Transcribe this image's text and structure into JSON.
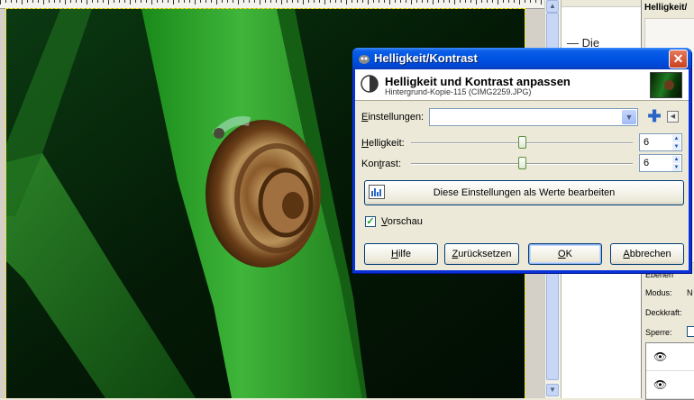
{
  "dialog": {
    "title": "Helligkeit/Kontrast",
    "header_title": "Helligkeit und Kontrast anpassen",
    "header_subtitle": "Hintergrund-Kopie-115 (CIMG2259.JPG)",
    "settings_label": "Einstellungen:",
    "settings_value": "",
    "brightness_label": "Helligkeit:",
    "brightness_value": "6",
    "contrast_label": "Kontrast:",
    "contrast_value": "6",
    "brightness_level": 0.5,
    "contrast_level": 0.5,
    "edit_values_label": "Diese Einstellungen als Werte bearbeiten",
    "preview_label": "Vorschau",
    "preview_checked": true,
    "buttons": {
      "help": "Hilfe",
      "reset": "Zurücksetzen",
      "ok": "OK",
      "cancel": "Abbrechen"
    }
  },
  "right_dock": {
    "title": "Helligkeit/",
    "mode_label": "Modus:",
    "mode_value": "N",
    "opacity_label": "Deckkraft:",
    "lock_label": "Sperre:",
    "section_label": "Ebenen"
  },
  "middle_panel": {
    "fragment": "— Die"
  },
  "colors": {
    "title_bar": "#0054e3",
    "dialog_bg": "#ece9d8",
    "close_button": "#c9401e",
    "selection_border": "#ffea00"
  },
  "icons": {
    "title": "gimp-icon",
    "header": "brightness-contrast-icon",
    "add": "plus-icon",
    "menu": "triangle-menu-icon",
    "eye": "eye-icon"
  }
}
